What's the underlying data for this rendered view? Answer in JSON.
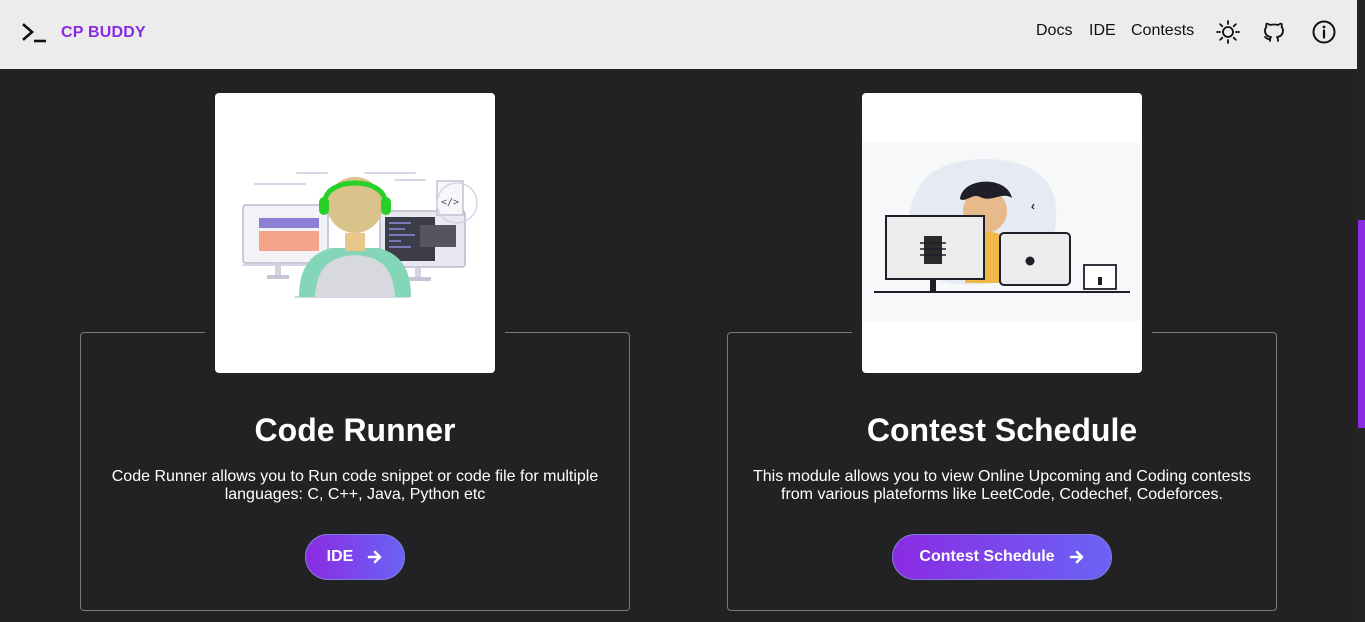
{
  "navbar": {
    "brand": "CP BUDDY",
    "links": [
      "Docs",
      "IDE",
      "Contests"
    ],
    "icons": [
      "sun-icon",
      "github-icon",
      "info-icon"
    ]
  },
  "cards": [
    {
      "title": "Code Runner",
      "description": "Code Runner allows you to Run code snippet or code file for multiple languages: C, C++, Java, Python etc",
      "button": "IDE"
    },
    {
      "title": "Contest Schedule",
      "description": "This module allows you to view Online Upcoming and Coding contests from various plateforms like LeetCode, Codechef, Codeforces.",
      "button": "Contest Schedule"
    }
  ],
  "colors": {
    "brand": "#8a2be2",
    "background": "#222224",
    "navbar": "#ececec",
    "button_start": "#8a2be2",
    "button_end": "#6b63f5"
  }
}
